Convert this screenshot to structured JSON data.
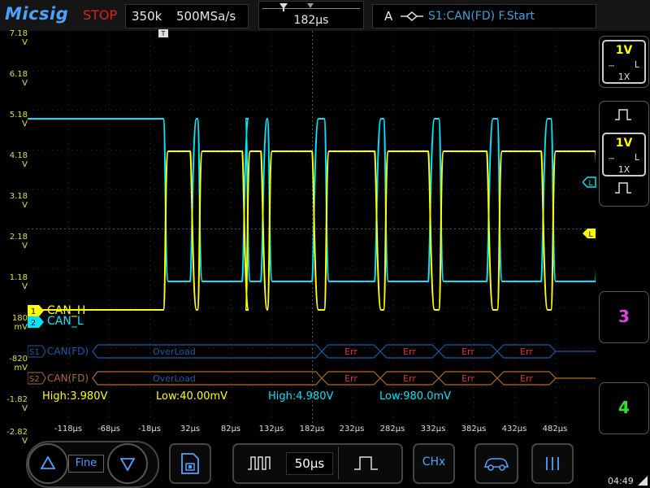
{
  "header": {
    "brand": "Micsig",
    "run_state": "STOP",
    "memory_depth": "350k",
    "sample_rate": "500MSa/s",
    "time_offset": "182µs",
    "trigger_mode": "A",
    "trigger_info": "S1:CAN(FD) F.Start"
  },
  "voltage_labels": [
    {
      "value": "7.18",
      "unit": "V"
    },
    {
      "value": "6.18",
      "unit": "V"
    },
    {
      "value": "5.18",
      "unit": "V"
    },
    {
      "value": "4.18",
      "unit": "V"
    },
    {
      "value": "3.18",
      "unit": "V"
    },
    {
      "value": "2.18",
      "unit": "V"
    },
    {
      "value": "1.18",
      "unit": "V"
    },
    {
      "value": "180",
      "unit": "mV"
    },
    {
      "value": "-820",
      "unit": "mV"
    },
    {
      "value": "-1.82",
      "unit": "V"
    },
    {
      "value": "-2.82",
      "unit": "V"
    }
  ],
  "time_labels": [
    "-118µs",
    "-68µs",
    "-18µs",
    "32µs",
    "82µs",
    "132µs",
    "182µs",
    "232µs",
    "282µs",
    "332µs",
    "382µs",
    "432µs",
    "482µs"
  ],
  "channels": [
    {
      "num": "1",
      "name": "CAN_H",
      "color": "#ffff00"
    },
    {
      "num": "2",
      "name": "CAN_L",
      "color": "#00e5ff"
    }
  ],
  "serial": [
    {
      "id": "S1",
      "protocol": "CAN(FD)",
      "frame": "OverLoad",
      "err": [
        "Err",
        "Err",
        "Err",
        "Err"
      ],
      "color": "#1c5aa8"
    },
    {
      "id": "S2",
      "protocol": "CAN(FD)",
      "frame": "OverLoad",
      "err": [
        "Err",
        "Err",
        "Err",
        "Err"
      ],
      "color": "#b06a2a"
    }
  ],
  "measurements": [
    {
      "text": "High:3.980V",
      "color": "#ffff00"
    },
    {
      "text": "Low:40.00mV",
      "color": "#ffff00"
    },
    {
      "text": "High:4.980V",
      "color": "#00e5ff"
    },
    {
      "text": "Low:980.0mV",
      "color": "#00e5ff"
    }
  ],
  "side": {
    "ch1": {
      "scale": "1V",
      "probe": "1X",
      "limit": "L",
      "color": "#ffff00"
    },
    "ch2": {
      "scale": "1V",
      "probe": "1X",
      "limit": "L",
      "color": "#ffff00"
    },
    "ch3": {
      "label": "3",
      "color": "#e040e0"
    },
    "ch4": {
      "label": "4",
      "color": "#30e030"
    }
  },
  "bottom": {
    "zoom_mode": "Fine",
    "timebase": "50µs",
    "chx_label": "CHx",
    "clock": "04:49"
  }
}
